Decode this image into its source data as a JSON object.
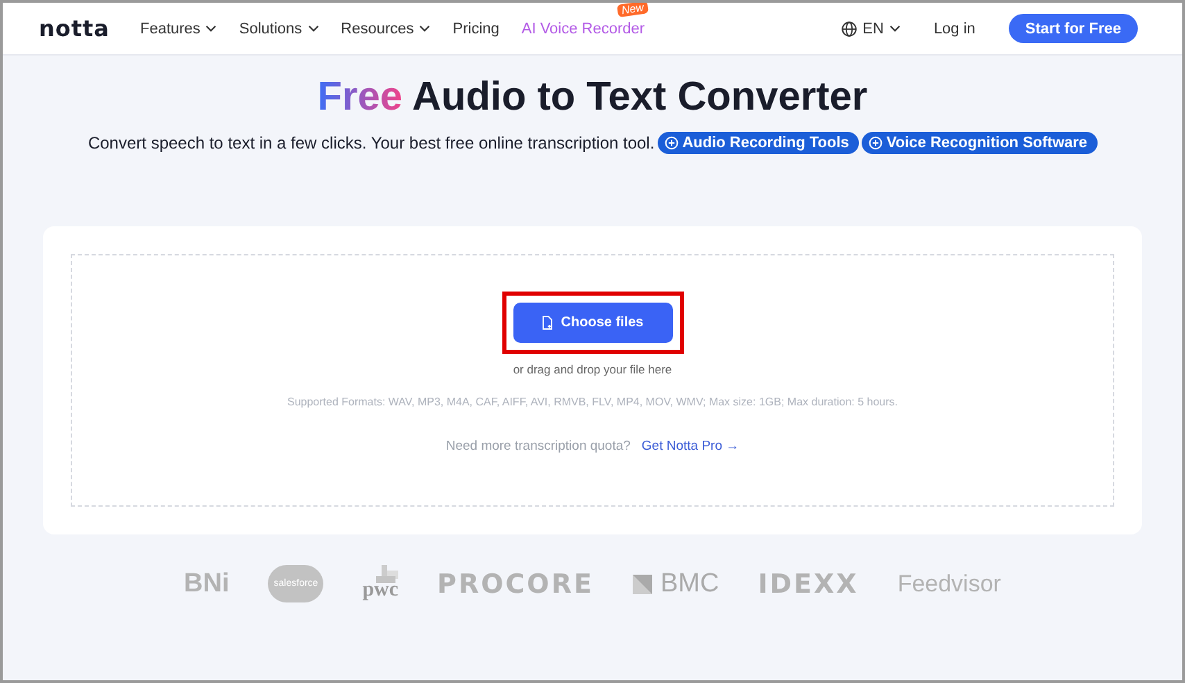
{
  "nav": {
    "logo": "notta",
    "menu": [
      {
        "label": "Features",
        "dropdown": true
      },
      {
        "label": "Solutions",
        "dropdown": true
      },
      {
        "label": "Resources",
        "dropdown": true
      },
      {
        "label": "Pricing",
        "dropdown": false
      },
      {
        "label": "AI Voice Recorder",
        "dropdown": false,
        "badge": "New"
      }
    ],
    "language": "EN",
    "login": "Log in",
    "cta": "Start for Free"
  },
  "hero": {
    "title_highlight": "Free",
    "title": "Audio to Text Converter",
    "subtitle": "Convert speech to text in a few clicks. Your best free online transcription tool.",
    "tags": [
      "Audio Recording Tools",
      "Voice Recognition Software"
    ]
  },
  "upload": {
    "button": "Choose files",
    "highlighted": true,
    "hint": "or drag and drop your file here",
    "formats": "Supported Formats: WAV, MP3, M4A, CAF, AIFF, AVI, RMVB, FLV, MP4, MOV, WMV; Max size: 1GB; Max duration: 5 hours.",
    "quota_text": "Need more transcription quota?",
    "quota_link": "Get Notta Pro →"
  },
  "logos": [
    {
      "kind": "bni",
      "text": "BNi"
    },
    {
      "kind": "cloud",
      "text": "salesforce"
    },
    {
      "kind": "pwc",
      "text": "pwc"
    },
    {
      "kind": "wide",
      "text": "PROCORE"
    },
    {
      "kind": "bmc",
      "text": "BMC"
    },
    {
      "kind": "wide",
      "text": "IDEXX"
    },
    {
      "kind": "plain",
      "text": "Feedvisor"
    }
  ]
}
